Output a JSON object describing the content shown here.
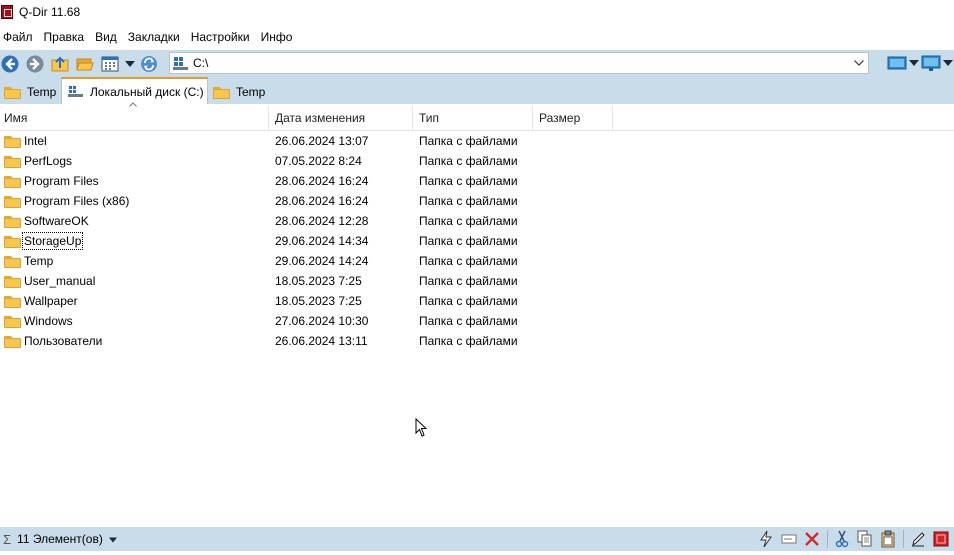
{
  "window": {
    "title": "Q-Dir 11.68"
  },
  "menu": [
    "Файл",
    "Правка",
    "Вид",
    "Закладки",
    "Настройки",
    "Инфо"
  ],
  "address": {
    "path": "C:\\"
  },
  "tabs": [
    {
      "label": "Temp",
      "icon": "folder-icon",
      "active": false
    },
    {
      "label": "Локальный диск (C:)",
      "icon": "drive-icon",
      "active": true
    },
    {
      "label": "Temp",
      "icon": "folder-icon",
      "active": false
    }
  ],
  "columns": {
    "name": "Имя",
    "date": "Дата изменения",
    "type": "Тип",
    "size": "Размер"
  },
  "rows": [
    {
      "name": "Intel",
      "date": "26.06.2024 13:07",
      "type": "Папка с файлами"
    },
    {
      "name": "PerfLogs",
      "date": "07.05.2022 8:24",
      "type": "Папка с файлами"
    },
    {
      "name": "Program Files",
      "date": "28.06.2024 16:24",
      "type": "Папка с файлами"
    },
    {
      "name": "Program Files (x86)",
      "date": "28.06.2024 16:24",
      "type": "Папка с файлами"
    },
    {
      "name": "SoftwareOK",
      "date": "28.06.2024 12:28",
      "type": "Папка с файлами"
    },
    {
      "name": "StorageUp",
      "date": "29.06.2024 14:34",
      "type": "Папка с файлами"
    },
    {
      "name": "Temp",
      "date": "29.06.2024 14:24",
      "type": "Папка с файлами"
    },
    {
      "name": "User_manual",
      "date": "18.05.2023 7:25",
      "type": "Папка с файлами"
    },
    {
      "name": "Wallpaper",
      "date": "18.05.2023 7:25",
      "type": "Папка с файлами"
    },
    {
      "name": "Windows",
      "date": "27.06.2024 10:30",
      "type": "Папка с файлами"
    },
    {
      "name": "Пользователи",
      "date": "26.06.2024 13:11",
      "type": "Папка с файлами"
    }
  ],
  "focused_row": "StorageUp",
  "status": {
    "sigma": "Σ",
    "count_text": "11 Элемент(ов)"
  },
  "colors": {
    "toolbar_bg": "#c8dcea",
    "tab_accent": "#e59a2a",
    "folder": "#f7c64c"
  }
}
